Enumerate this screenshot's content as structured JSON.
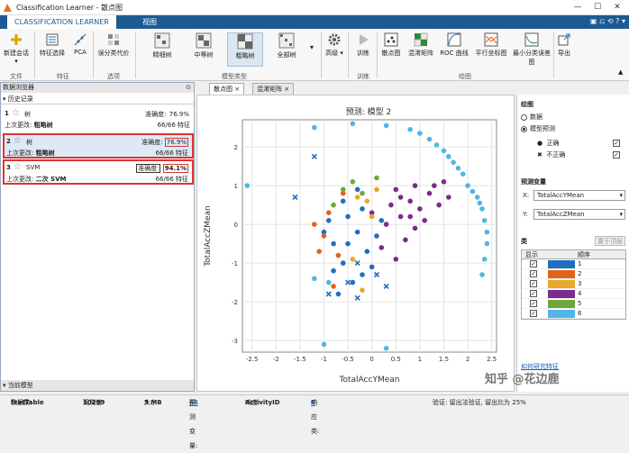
{
  "window": {
    "title": "Classification Learner - 散点图"
  },
  "ribbon_tabs": [
    "CLASSIFICATION LEARNER",
    "视图"
  ],
  "ribbon": {
    "buttons": [
      {
        "label": "新建会话",
        "icon": "new-session-icon"
      },
      {
        "label": "特征选择",
        "icon": "feature-selection-icon"
      },
      {
        "label": "PCA",
        "icon": "pca-icon"
      },
      {
        "label": "误分类代价",
        "icon": "misclassification-cost-icon"
      },
      {
        "label": "精细树",
        "icon": "fine-tree-icon"
      },
      {
        "label": "中等树",
        "icon": "medium-tree-icon"
      },
      {
        "label": "粗略树",
        "icon": "coarse-tree-icon"
      },
      {
        "label": "全部树",
        "icon": "all-trees-icon"
      },
      {
        "label": "高级",
        "icon": "advanced-icon"
      },
      {
        "label": "训练",
        "icon": "train-icon"
      },
      {
        "label": "散点图",
        "icon": "scatter-plot-icon"
      },
      {
        "label": "混淆矩阵",
        "icon": "confusion-matrix-icon"
      },
      {
        "label": "ROC 曲线",
        "icon": "roc-curve-icon"
      },
      {
        "label": "平行坐标图",
        "icon": "parallel-coordinates-icon"
      },
      {
        "label": "最小分类误差图",
        "icon": "min-error-plot-icon"
      },
      {
        "label": "导出",
        "icon": "export-icon"
      }
    ],
    "groups": [
      "文件",
      "特征",
      "选项",
      "模型类型",
      "训练",
      "绘图"
    ]
  },
  "data_browser": {
    "header": "数据浏览器",
    "history_label": "历史记录",
    "footer": "当前模型",
    "models": [
      {
        "num": "1",
        "name": "树",
        "acc_label": "准确度:",
        "acc": "76.9%",
        "last_label": "上次更改:",
        "last": "粗略树",
        "features": "66/66 特征"
      },
      {
        "num": "2",
        "name": "树",
        "acc_label": "准确度:",
        "acc": "76.9%",
        "last_label": "上次更改:",
        "last": "粗略树",
        "features": "66/66 特征"
      },
      {
        "num": "3",
        "name": "SVM",
        "acc_label": "准确度:",
        "acc": "94.1%",
        "last_label": "上次更改:",
        "last": "二次 SVM",
        "features": "66/66 特征"
      }
    ]
  },
  "doc_tabs": [
    "散点图",
    "混淆矩阵"
  ],
  "right_panel": {
    "plot_title": "绘图",
    "radio_data": "数据",
    "radio_pred": "模型预测",
    "correct": "正确",
    "incorrect": "不正确",
    "predictors_title": "预测变量",
    "x_label": "X:",
    "x_value": "TotalAccYMean",
    "y_label": "Y:",
    "y_value": "TotalAccZMean",
    "class_title": "类",
    "reorder_button": "置于顶层",
    "col_show": "显示",
    "col_order": "顺序",
    "explore_link": "如何研究特征"
  },
  "status": {
    "dataset_label": "数据集:",
    "dataset": "featTable",
    "obs_label": "观测值:",
    "obs": "10299",
    "size_label": "大小:",
    "size": "5 MB",
    "pred_label": "预测变量:",
    "pred": "66",
    "resp_label": "响应:",
    "resp": "ActivityID",
    "classes_label": "响应类:",
    "classes": "6",
    "validation": "验证: 留出法验证, 留出比为 25%"
  },
  "watermark": "知乎 @花边鹿",
  "chart_data": {
    "type": "scatter",
    "title": "预测: 模型 2",
    "xlabel": "TotalAccYMean",
    "ylabel": "TotalAccZMean",
    "xlim": [
      -2.7,
      2.6
    ],
    "ylim": [
      -3.3,
      2.7
    ],
    "xticks": [
      -2.5,
      -2,
      -1.5,
      -1,
      -0.5,
      0,
      0.5,
      1,
      1.5,
      2,
      2.5
    ],
    "yticks": [
      -3,
      -2,
      -1,
      0,
      1,
      2
    ],
    "classes": [
      {
        "name": "1",
        "color": "#1f6fbf"
      },
      {
        "name": "2",
        "color": "#e0641a"
      },
      {
        "name": "3",
        "color": "#e8a82a"
      },
      {
        "name": "4",
        "color": "#7c2a8c"
      },
      {
        "name": "5",
        "color": "#6fa63a"
      },
      {
        "name": "6",
        "color": "#52b5e6"
      }
    ],
    "series": [
      {
        "name": "6",
        "points": [
          [
            -1.2,
            2.5
          ],
          [
            -0.4,
            2.6
          ],
          [
            0.3,
            2.55
          ],
          [
            0.8,
            2.45
          ],
          [
            1.2,
            2.2
          ],
          [
            1.5,
            1.9
          ],
          [
            1.7,
            1.6
          ],
          [
            1.9,
            1.3
          ],
          [
            2.0,
            1.0
          ],
          [
            2.2,
            0.7
          ],
          [
            2.3,
            0.4
          ],
          [
            2.35,
            0.1
          ],
          [
            2.4,
            -0.2
          ],
          [
            2.4,
            -0.5
          ],
          [
            2.35,
            -0.9
          ],
          [
            2.3,
            -1.3
          ],
          [
            1.0,
            2.35
          ],
          [
            1.35,
            2.05
          ],
          [
            1.6,
            1.75
          ],
          [
            1.8,
            1.45
          ],
          [
            2.1,
            0.85
          ],
          [
            2.25,
            0.55
          ],
          [
            -2.6,
            1.0
          ],
          [
            -1.0,
            -3.1
          ],
          [
            -0.9,
            -1.5
          ],
          [
            0.3,
            -3.2
          ],
          [
            -1.2,
            -1.4
          ]
        ]
      },
      {
        "name": "4",
        "points": [
          [
            0.5,
            0.9
          ],
          [
            0.8,
            0.6
          ],
          [
            1.0,
            0.4
          ],
          [
            1.2,
            0.8
          ],
          [
            0.6,
            0.2
          ],
          [
            0.9,
            -0.1
          ],
          [
            1.4,
            0.5
          ],
          [
            0.4,
            0.5
          ],
          [
            0.7,
            -0.4
          ],
          [
            1.1,
            0.1
          ],
          [
            0.3,
            0.0
          ],
          [
            1.3,
            1.0
          ],
          [
            0.2,
            -0.6
          ],
          [
            0.5,
            -0.9
          ],
          [
            1.6,
            0.7
          ],
          [
            0.9,
            1.0
          ],
          [
            0.6,
            0.7
          ],
          [
            0.0,
            0.3
          ],
          [
            1.5,
            1.1
          ],
          [
            0.8,
            0.2
          ]
        ]
      },
      {
        "name": "1",
        "points": [
          [
            -0.5,
            0.2
          ],
          [
            -0.3,
            -0.2
          ],
          [
            -0.8,
            -0.5
          ],
          [
            -0.2,
            0.4
          ],
          [
            -0.6,
            -1.0
          ],
          [
            -0.1,
            -0.7
          ],
          [
            -0.4,
            -1.5
          ],
          [
            0.1,
            -0.3
          ],
          [
            -0.9,
            0.1
          ],
          [
            -0.7,
            -1.8
          ],
          [
            -0.3,
            0.9
          ],
          [
            -0.5,
            -0.5
          ],
          [
            0.2,
            0.1
          ],
          [
            -1.0,
            -0.2
          ],
          [
            0.0,
            -1.1
          ],
          [
            -0.6,
            0.6
          ],
          [
            -0.2,
            -1.3
          ],
          [
            -0.8,
            -1.2
          ]
        ]
      },
      {
        "name": "2",
        "points": [
          [
            -0.9,
            0.3
          ],
          [
            -1.0,
            -0.3
          ],
          [
            -0.7,
            -0.8
          ],
          [
            -1.2,
            0.0
          ],
          [
            -0.8,
            -1.6
          ],
          [
            -0.6,
            0.8
          ],
          [
            -1.1,
            -0.7
          ]
        ]
      },
      {
        "name": "3",
        "points": [
          [
            -0.3,
            0.7
          ],
          [
            -0.1,
            0.6
          ],
          [
            0.0,
            0.2
          ],
          [
            -0.4,
            -0.9
          ],
          [
            -0.2,
            -1.7
          ],
          [
            0.1,
            0.9
          ]
        ]
      },
      {
        "name": "5",
        "points": [
          [
            -0.6,
            0.9
          ],
          [
            -0.4,
            1.1
          ],
          [
            -0.8,
            0.5
          ],
          [
            0.1,
            1.2
          ],
          [
            -0.2,
            0.8
          ]
        ]
      }
    ],
    "incorrect": [
      [
        -1.2,
        1.75
      ],
      [
        -1.6,
        0.7
      ],
      [
        -0.3,
        -1.9
      ],
      [
        -0.9,
        -1.8
      ],
      [
        0.3,
        -1.6
      ],
      [
        -0.5,
        -1.5
      ],
      [
        0.1,
        -1.3
      ],
      [
        -0.3,
        -1.0
      ]
    ]
  }
}
